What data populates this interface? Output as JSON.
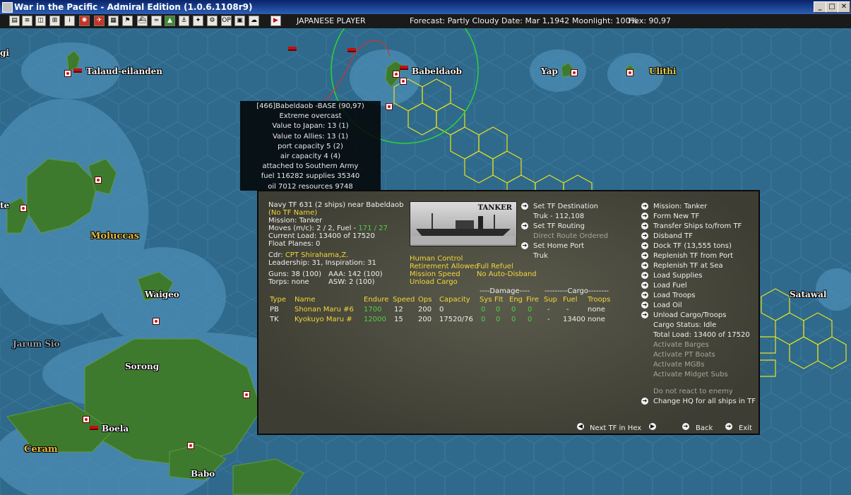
{
  "window": {
    "title": "War in the Pacific - Admiral Edition (1.0.6.1108r9)"
  },
  "toolbar": {
    "player": "JAPANESE PLAYER",
    "forecast": "Forecast: Partly Cloudy",
    "date": "Date: Mar 1,1942",
    "moonlight": "Moonlight: 100%",
    "hex": "Hex: 90,97"
  },
  "map": {
    "labels": {
      "gi": "gi",
      "talaud": "Talaud-eilanden",
      "babeldaob": "Babeldaob",
      "yap": "Yap",
      "ulithi": "Ulithi",
      "te": "te",
      "moluccas": "Moluccas",
      "waigeo": "Waigeo",
      "satawal": "Satawal",
      "jarum_sio": "Jarum Sio",
      "sorong": "Sorong",
      "boela": "Boela",
      "ceram": "Ceram",
      "babo": "Babo"
    }
  },
  "base_info": {
    "lines": [
      "[466]Babeldaob -BASE (90,97)",
      "Extreme overcast",
      "Value to Japan: 13 (1)",
      "Value to Allies: 13 (1)",
      "port capacity 5 (2)",
      "air capacity 4 (4)",
      "attached to Southern Army",
      "fuel 116282 supplies 35340",
      "oil 7012 resources 9748"
    ]
  },
  "tf": {
    "header": "Navy TF 631 (2 ships) near Babeldaob",
    "name": "(No TF Name)",
    "mission": "Mission: Tanker",
    "moves_prefix": "Moves (m/c): 2 / 2, Fuel - ",
    "fuel_range": "171 / 27",
    "current_load": "Current Load: 13400 of 17520",
    "float_planes": "Float Planes: 0",
    "cdr_label": "Cdr:",
    "cdr_name": "CPT Shirahama,Z.",
    "leadership": "Leadership: 31, Inspiration: 31",
    "guns": "Guns: 38 (100)",
    "aaa": "AAA: 142 (100)",
    "torps": "Torps: none",
    "asw": "ASW: 2 (100)",
    "image_label": "TANKER",
    "options_left": [
      "Human Control",
      "Retirement Allowed",
      "Mission Speed",
      "Unload Cargo"
    ],
    "options_right": [
      "Full Refuel",
      "No Auto-Disband"
    ],
    "destination": {
      "set_dest": "Set TF Destination",
      "dest_value": "Truk - 112,108",
      "set_routing": "Set TF Routing",
      "routing_value": "Direct Route Ordered",
      "set_home": "Set Home Port",
      "home_value": "Truk"
    },
    "table": {
      "damage_header": "----Damage----",
      "cargo_header": "---------Cargo--------",
      "columns": [
        "Type",
        "Name",
        "Endure",
        "Speed",
        "Ops",
        "Capacity",
        "Sys",
        "Flt",
        "Eng",
        "Fire",
        "Sup",
        "Fuel",
        "Troops"
      ],
      "rows": [
        [
          "PB",
          "Shonan Maru #6",
          "1700",
          "12",
          "200",
          "0",
          "0",
          "0",
          "0",
          "0",
          "-",
          "-",
          "none"
        ],
        [
          "TK",
          "Kyokuyo Maru #",
          "12000",
          "15",
          "200",
          "17520/76",
          "0",
          "0",
          "0",
          "0",
          "-",
          "13400",
          "none"
        ]
      ]
    },
    "menu": [
      "Mission: Tanker",
      "Form New TF",
      "Transfer Ships to/from TF",
      "Disband TF",
      "Dock TF (13,555 tons)",
      "Replenish TF from Port",
      "Replenish TF at Sea",
      "Load Supplies",
      "Load Fuel",
      "Load Troops",
      "Load Oil",
      "Unload Cargo/Troops"
    ],
    "cargo_status": "Cargo Status: Idle",
    "total_load": "Total Load: 13400 of 17520",
    "disabled_items": [
      "Activate Barges",
      "Activate PT Boats",
      "Activate MGBs",
      "Activate Midget Subs"
    ],
    "do_not_react": "Do not react to enemy",
    "change_hq": "Change HQ for all ships in TF",
    "footer": {
      "next": "Next TF in Hex",
      "back": "Back",
      "exit": "Exit"
    }
  }
}
